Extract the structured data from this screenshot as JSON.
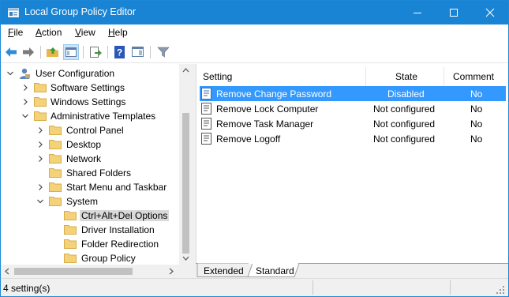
{
  "window": {
    "title": "Local Group Policy Editor",
    "accent": "#1983d4"
  },
  "menu": [
    {
      "key": "F",
      "rest": "ile"
    },
    {
      "key": "A",
      "rest": "ction"
    },
    {
      "key": "V",
      "rest": "iew"
    },
    {
      "key": "H",
      "rest": "elp"
    }
  ],
  "toolbar": {
    "icons": [
      "back-arrow-icon",
      "forward-arrow-icon",
      "up-folder-icon",
      "show-hide-tree-icon",
      "export-list-icon",
      "help-icon",
      "properties-pane-icon",
      "filter-icon"
    ]
  },
  "tree": {
    "items": [
      {
        "label": "User Configuration",
        "level": 0,
        "expanded": true
      },
      {
        "label": "Software Settings",
        "level": 1,
        "expanded": false
      },
      {
        "label": "Windows Settings",
        "level": 1,
        "expanded": false
      },
      {
        "label": "Administrative Templates",
        "level": 1,
        "expanded": true
      },
      {
        "label": "Control Panel",
        "level": 2,
        "expanded": false
      },
      {
        "label": "Desktop",
        "level": 2,
        "expanded": false
      },
      {
        "label": "Network",
        "level": 2,
        "expanded": false
      },
      {
        "label": "Shared Folders",
        "level": 2,
        "expanded": null
      },
      {
        "label": "Start Menu and Taskbar",
        "level": 2,
        "expanded": false
      },
      {
        "label": "System",
        "level": 2,
        "expanded": true
      },
      {
        "label": "Ctrl+Alt+Del Options",
        "level": 3,
        "expanded": null,
        "selected": true
      },
      {
        "label": "Driver Installation",
        "level": 3,
        "expanded": null
      },
      {
        "label": "Folder Redirection",
        "level": 3,
        "expanded": null
      },
      {
        "label": "Group Policy",
        "level": 3,
        "expanded": null
      }
    ]
  },
  "list": {
    "columns": [
      "Setting",
      "State",
      "Comment"
    ],
    "rows": [
      {
        "setting": "Remove Change Password",
        "state": "Disabled",
        "comment": "No",
        "selected": true
      },
      {
        "setting": "Remove Lock Computer",
        "state": "Not configured",
        "comment": "No"
      },
      {
        "setting": "Remove Task Manager",
        "state": "Not configured",
        "comment": "No"
      },
      {
        "setting": "Remove Logoff",
        "state": "Not configured",
        "comment": "No"
      }
    ],
    "selected_color": "#3399ff"
  },
  "tabs": [
    {
      "label": "Extended",
      "active": false
    },
    {
      "label": "Standard",
      "active": true
    }
  ],
  "status": {
    "text": "4 setting(s)"
  }
}
